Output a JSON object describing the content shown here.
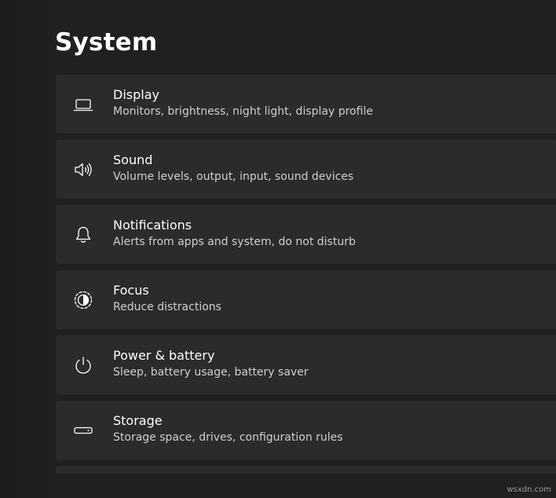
{
  "page": {
    "title": "System"
  },
  "items": [
    {
      "id": "display",
      "icon": "laptop-icon",
      "label": "Display",
      "description": "Monitors, brightness, night light, display profile"
    },
    {
      "id": "sound",
      "icon": "speaker-icon",
      "label": "Sound",
      "description": "Volume levels, output, input, sound devices"
    },
    {
      "id": "notifications",
      "icon": "bell-icon",
      "label": "Notifications",
      "description": "Alerts from apps and system, do not disturb"
    },
    {
      "id": "focus",
      "icon": "focus-icon",
      "label": "Focus",
      "description": "Reduce distractions"
    },
    {
      "id": "power",
      "icon": "power-icon",
      "label": "Power & battery",
      "description": "Sleep, battery usage, battery saver"
    },
    {
      "id": "storage",
      "icon": "storage-drive-icon",
      "label": "Storage",
      "description": "Storage space, drives, configuration rules"
    }
  ],
  "watermark": "wsxdn.com",
  "colors": {
    "background": "#202020",
    "card": "#2b2b2b",
    "text": "#ffffff",
    "secondary_text": "#cfcfcf"
  }
}
